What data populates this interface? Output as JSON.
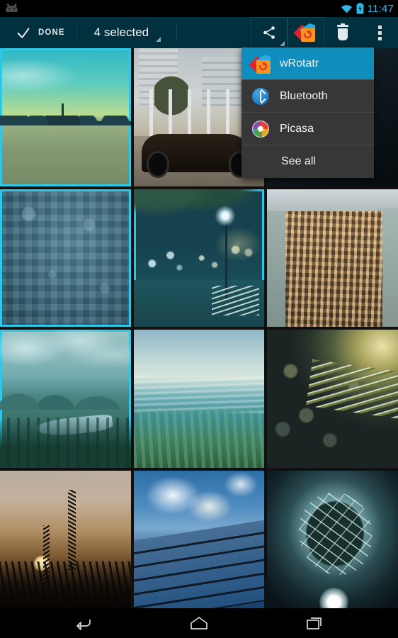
{
  "status_bar": {
    "notification_icon": "android-mascot-icon",
    "wifi_icon": "wifi-icon",
    "battery_icon": "battery-charging-icon",
    "clock": "11:47",
    "accent_color": "#33b5e5"
  },
  "action_bar": {
    "done_label": "DONE",
    "check_icon": "checkmark-icon",
    "selection_count_label": "4 selected",
    "dropdown_icon": "triangle-down-icon",
    "background_color": "#01303f",
    "actions": [
      {
        "name": "share-action",
        "icon": "share-icon",
        "has_dropdown": true
      },
      {
        "name": "wrotatr-action",
        "icon": "wrotatr-app-icon",
        "has_dropdown": false
      },
      {
        "name": "delete-action",
        "icon": "trash-icon",
        "has_dropdown": false
      },
      {
        "name": "overflow-action",
        "icon": "overflow-menu-icon",
        "has_dropdown": false
      }
    ]
  },
  "share_menu": {
    "items": [
      {
        "label": "wRotatr",
        "icon": "wrotatr-app-icon",
        "highlighted": true
      },
      {
        "label": "Bluetooth",
        "icon": "bluetooth-icon",
        "highlighted": false
      },
      {
        "label": "Picasa",
        "icon": "picasa-icon",
        "highlighted": false
      },
      {
        "label": "See all",
        "icon": "",
        "highlighted": false
      }
    ],
    "highlight_color": "#0f8dbd",
    "background_color": "#373737"
  },
  "gallery": {
    "selection_border_color": "#2ec8e6",
    "selected_count": 4,
    "columns": 3,
    "rows": 4,
    "items": [
      {
        "name": "photo-green-field",
        "art": "art-field",
        "selected": true
      },
      {
        "name": "photo-black-car-street",
        "art": "art-car",
        "selected": false
      },
      {
        "name": "photo-dark-abstract",
        "art": "art-dark1",
        "selected": false
      },
      {
        "name": "photo-pixel-mosaic",
        "art": "art-mosaic",
        "selected": true
      },
      {
        "name": "photo-night-park-lamp",
        "art": "art-lamp",
        "selected": true
      },
      {
        "name": "photo-aerial-cityscape",
        "art": "art-city",
        "selected": false
      },
      {
        "name": "photo-mountain-lake",
        "art": "art-mtn",
        "selected": true
      },
      {
        "name": "photo-water-surface",
        "art": "art-water",
        "selected": false
      },
      {
        "name": "photo-snowy-branch",
        "art": "art-branch",
        "selected": false
      },
      {
        "name": "photo-sunset-wheat",
        "art": "art-sunset",
        "selected": false
      },
      {
        "name": "photo-glass-building",
        "art": "art-glass",
        "selected": false
      },
      {
        "name": "photo-shattered-glass",
        "art": "art-shatter",
        "selected": false
      }
    ]
  },
  "nav_bar": {
    "buttons": [
      {
        "name": "nav-back-button",
        "icon": "back-arrow-icon"
      },
      {
        "name": "nav-home-button",
        "icon": "home-icon"
      },
      {
        "name": "nav-recents-button",
        "icon": "recents-icon"
      }
    ]
  }
}
